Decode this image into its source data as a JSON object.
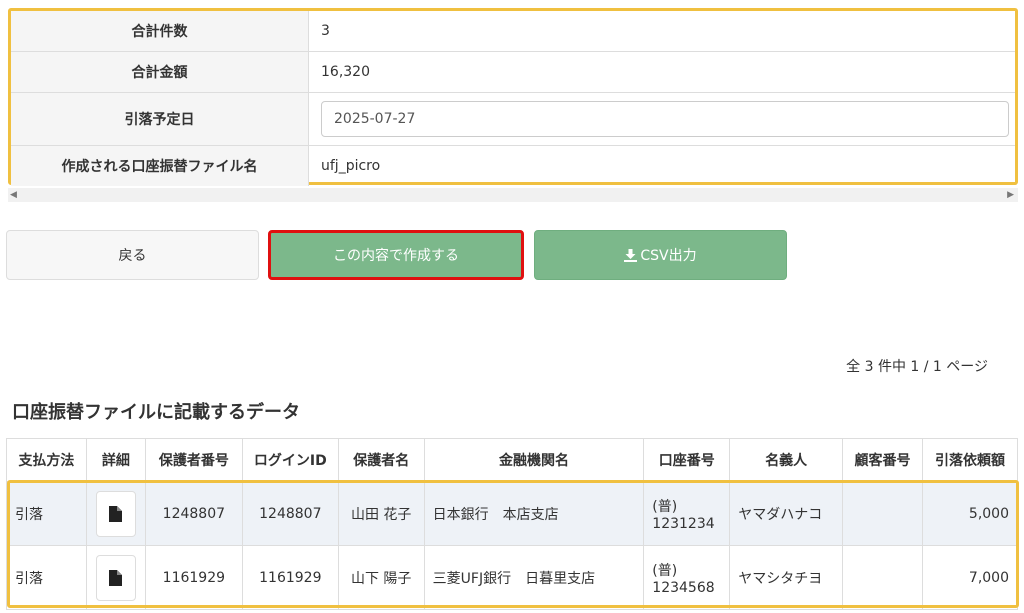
{
  "summary": {
    "total_count_label": "合計件数",
    "total_count": "3",
    "total_amount_label": "合計金額",
    "total_amount": "16,320",
    "withdraw_date_label": "引落予定日",
    "withdraw_date": "2025-07-27",
    "file_name_label": "作成される口座振替ファイル名",
    "file_name": "ufj_picro"
  },
  "buttons": {
    "back": "戻る",
    "create": "この内容で作成する",
    "csv": "CSV出力"
  },
  "pager": "全 3 件中 1 / 1 ページ",
  "section_title": "口座振替ファイルに記載するデータ",
  "table": {
    "headers": [
      "支払方法",
      "詳細",
      "保護者番号",
      "ログインID",
      "保護者名",
      "金融機関名",
      "口座番号",
      "名義人",
      "顧客番号",
      "引落依頼額"
    ],
    "rows": [
      {
        "method": "引落",
        "guardian_no": "1248807",
        "login_id": "1248807",
        "guardian_name": "山田 花子",
        "bank": "日本銀行　本店支店",
        "account": "(普) 1231234",
        "holder": "ヤマダハナコ",
        "customer_no": "",
        "amount": "5,000"
      },
      {
        "method": "引落",
        "guardian_no": "1161929",
        "login_id": "1161929",
        "guardian_name": "山下 陽子",
        "bank": "三菱UFJ銀行　日暮里支店",
        "account": "(普) 1234568",
        "holder": "ヤマシタチヨ",
        "customer_no": "",
        "amount": "7,000"
      }
    ]
  },
  "colors": {
    "primary_green": "#7cb88b",
    "highlight": "#f0c040",
    "danger": "#e01010"
  },
  "icons": {
    "download": "download-icon",
    "document": "document-icon"
  }
}
